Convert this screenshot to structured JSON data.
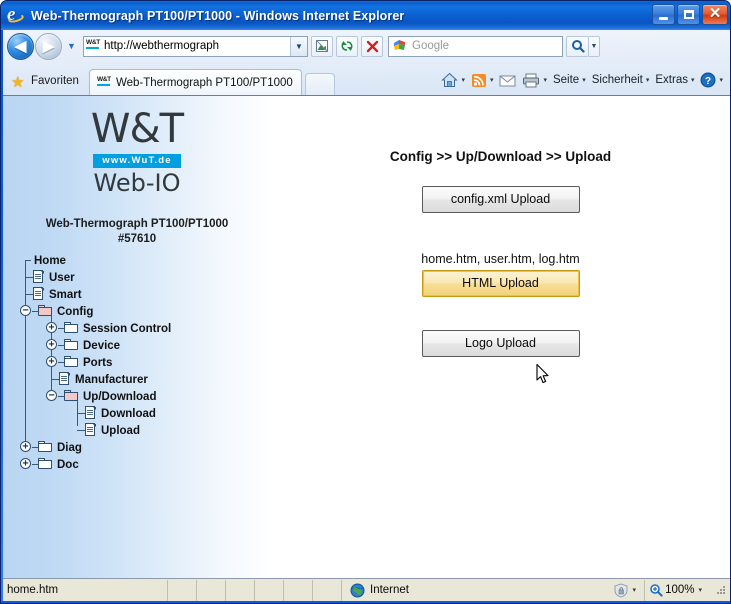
{
  "window": {
    "title": "Web-Thermograph PT100/PT1000 - Windows Internet Explorer",
    "minimize_label": "_",
    "maximize_label": "",
    "close_label": "✕"
  },
  "navigation": {
    "back_glyph": "◀",
    "forward_glyph": "▶",
    "recent_pages_glyph": "▼",
    "address_value": "http://webthermograph",
    "address_dropdown_glyph": "▼",
    "favicon_text": "W&T",
    "compat_view_label": "",
    "refresh_label": "",
    "stop_label": "✕",
    "search_placeholder": "Google",
    "search_go_glyph": "⚲",
    "search_dropdown_glyph": "▼"
  },
  "tabbar": {
    "favorites_label": "Favoriten",
    "tabs": [
      {
        "label": "Web-Thermograph PT100/PT1000",
        "active": true
      }
    ],
    "commands": [
      {
        "name": "home",
        "label": ""
      },
      {
        "name": "feeds",
        "label": ""
      },
      {
        "name": "mail",
        "label": ""
      },
      {
        "name": "print",
        "label": ""
      },
      {
        "name": "page",
        "label": "Seite"
      },
      {
        "name": "safety",
        "label": "Sicherheit"
      },
      {
        "name": "tools",
        "label": "Extras"
      },
      {
        "name": "help",
        "label": ""
      }
    ],
    "caret_glyph": "▾"
  },
  "sidebar": {
    "logo_text": "W&T",
    "logo_url": "www.WuT.de",
    "logo_product": "Web-IO",
    "device_name": "Web-Thermograph PT100/PT1000",
    "device_serial": "#57610",
    "tree": [
      {
        "label": "Home",
        "level": 0,
        "icon": "none",
        "toggle": "none"
      },
      {
        "label": "User",
        "level": 0,
        "icon": "document",
        "toggle": "none"
      },
      {
        "label": "Smart",
        "level": 0,
        "icon": "document",
        "toggle": "none"
      },
      {
        "label": "Config",
        "level": 0,
        "icon": "folder-open",
        "toggle": "minus"
      },
      {
        "label": "Session Control",
        "level": 1,
        "icon": "folder",
        "toggle": "plus"
      },
      {
        "label": "Device",
        "level": 1,
        "icon": "folder",
        "toggle": "plus"
      },
      {
        "label": "Ports",
        "level": 1,
        "icon": "folder",
        "toggle": "plus"
      },
      {
        "label": "Manufacturer",
        "level": 1,
        "icon": "document",
        "toggle": "none"
      },
      {
        "label": "Up/Download",
        "level": 1,
        "icon": "folder-open",
        "toggle": "minus"
      },
      {
        "label": "Download",
        "level": 2,
        "icon": "document",
        "toggle": "none"
      },
      {
        "label": "Upload",
        "level": 2,
        "icon": "document",
        "toggle": "none"
      },
      {
        "label": "Diag",
        "level": 0,
        "icon": "folder",
        "toggle": "plus"
      },
      {
        "label": "Doc",
        "level": 0,
        "icon": "folder",
        "toggle": "plus"
      }
    ]
  },
  "content": {
    "breadcrumb_title": "Config >> Up/Download >> Upload",
    "config_upload_button": "config.xml Upload",
    "html_files_note": "home.htm, user.htm, log.htm",
    "html_upload_button": "HTML Upload",
    "logo_upload_button": "Logo Upload"
  },
  "statusbar": {
    "status_text": "home.htm",
    "zone_label": "Internet",
    "protected_caret": "▾",
    "zoom_label": "100%",
    "zoom_caret": "▾"
  },
  "colors": {
    "accent_blue": "#00a0e0",
    "titlebar_blue": "#0a5ae8",
    "sidebar_blue": "#b9d6f2",
    "hover_button": "#f3d27a",
    "status_bg": "#e9e8d8"
  }
}
